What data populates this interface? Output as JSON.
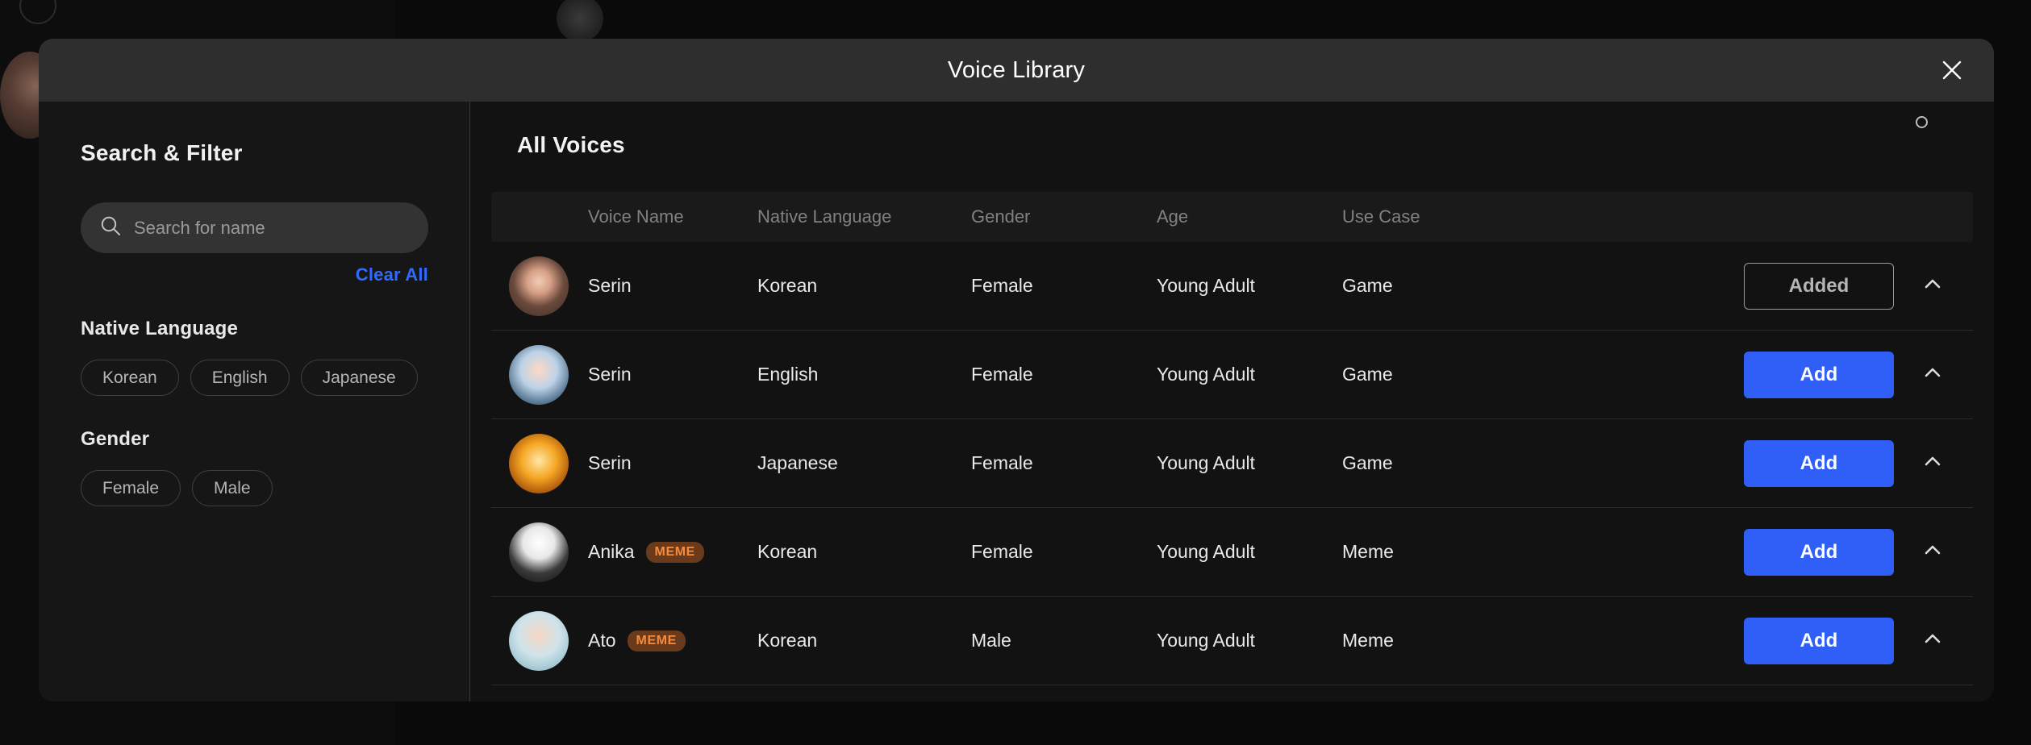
{
  "modal": {
    "title": "Voice Library",
    "close_icon": "close-icon"
  },
  "sidebar": {
    "title": "Search & Filter",
    "search": {
      "icon": "search-icon",
      "placeholder": "Search for name",
      "value": ""
    },
    "clear_all_label": "Clear All",
    "groups": [
      {
        "title": "Native Language",
        "chips": [
          "Korean",
          "English",
          "Japanese"
        ]
      },
      {
        "title": "Gender",
        "chips": [
          "Female",
          "Male"
        ]
      }
    ]
  },
  "content": {
    "title": "All Voices",
    "columns": [
      "",
      "Voice Name",
      "Native Language",
      "Gender",
      "Age",
      "Use Case",
      ""
    ],
    "rows": [
      {
        "avatar": "avatar-serin-korean",
        "name": "Serin",
        "badge": "",
        "native_language": "Korean",
        "gender": "Female",
        "age": "Young Adult",
        "use_case": "Game",
        "action_label": "Added",
        "action_state": "added",
        "expand_icon": "chevron-up-icon"
      },
      {
        "avatar": "avatar-serin-english",
        "name": "Serin",
        "badge": "",
        "native_language": "English",
        "gender": "Female",
        "age": "Young Adult",
        "use_case": "Game",
        "action_label": "Add",
        "action_state": "add",
        "expand_icon": "chevron-up-icon"
      },
      {
        "avatar": "avatar-serin-japanese",
        "name": "Serin",
        "badge": "",
        "native_language": "Japanese",
        "gender": "Female",
        "age": "Young Adult",
        "use_case": "Game",
        "action_label": "Add",
        "action_state": "add",
        "expand_icon": "chevron-up-icon"
      },
      {
        "avatar": "avatar-anika",
        "name": "Anika",
        "badge": "MEME",
        "native_language": "Korean",
        "gender": "Female",
        "age": "Young Adult",
        "use_case": "Meme",
        "action_label": "Add",
        "action_state": "add",
        "expand_icon": "chevron-up-icon"
      },
      {
        "avatar": "avatar-ato",
        "name": "Ato",
        "badge": "MEME",
        "native_language": "Korean",
        "gender": "Male",
        "age": "Young Adult",
        "use_case": "Meme",
        "action_label": "Add",
        "action_state": "add",
        "expand_icon": "chevron-up-icon"
      }
    ]
  },
  "colors": {
    "accent_blue": "#2f5ff7",
    "link_blue": "#2f6bff",
    "badge_bg": "#6a3a1c",
    "badge_text": "#f58b3c",
    "modal_bg": "#131313",
    "header_bg": "#2e2e2e"
  }
}
